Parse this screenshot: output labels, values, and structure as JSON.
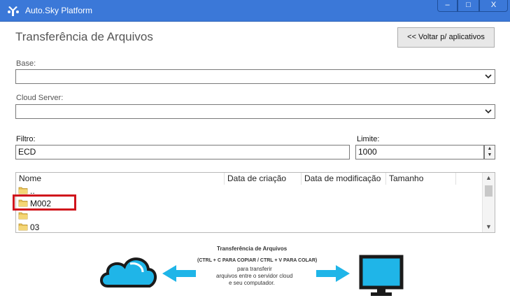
{
  "window": {
    "title": "Auto.Sky Platform",
    "controls": {
      "minimize": "–",
      "maximize": "□",
      "close": "X"
    }
  },
  "header": {
    "title": "Transferência de Arquivos",
    "back_button": "<< Voltar p/ aplicativos"
  },
  "form": {
    "base_label": "Base:",
    "base_value": "",
    "cloud_label": "Cloud Server:",
    "cloud_value": "",
    "filter_label": "Filtro:",
    "filter_value": "ECD",
    "limit_label": "Limite:",
    "limit_value": "1000"
  },
  "list": {
    "columns": [
      "Nome",
      "Data de criação",
      "Data de modificação",
      "Tamanho"
    ],
    "rows": [
      {
        "name": "..",
        "icon": "folder-icon"
      },
      {
        "name": "M002",
        "icon": "folder-icon"
      },
      {
        "name": "",
        "icon": "folder-icon"
      },
      {
        "name": "03",
        "icon": "folder-icon"
      }
    ]
  },
  "banner": {
    "title": "Transferência de Arquivos",
    "shortcut": "(CTRL + C PARA COPIAR / CTRL + V PARA COLAR)",
    "line1": "para transferir",
    "line2": "arquivos entre o servidor cloud",
    "line3": "e seu computador.",
    "colors": {
      "accent": "#1fb5e8",
      "dark": "#1a1a1a"
    }
  },
  "colors": {
    "titlebar": "#3b78d8",
    "highlight": "#d0141c"
  }
}
